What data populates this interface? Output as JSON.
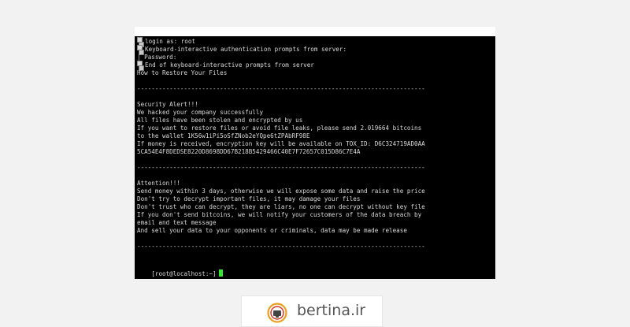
{
  "terminal": {
    "lines": [
      {
        "text": "login as: root",
        "indent": true
      },
      {
        "text": "Keyboard-interactive authentication prompts from server:",
        "indent": true
      },
      {
        "text": "| Password:",
        "indent": false
      },
      {
        "text": "End of keyboard-interactive prompts from server",
        "indent": true
      },
      {
        "text": "How to Restore Your Files",
        "indent": false
      },
      {
        "text": "",
        "indent": false
      },
      {
        "text": "--------------------------------------------------------------------------------",
        "indent": false
      },
      {
        "text": "",
        "indent": false
      },
      {
        "text": "Security Alert!!!",
        "indent": false
      },
      {
        "text": "We hacked your company successfully",
        "indent": false
      },
      {
        "text": "All files have been stolen and encrypted by us",
        "indent": false
      },
      {
        "text": "If you want to restore files or avoid file leaks, please send 2.019664 bitcoins",
        "indent": false
      },
      {
        "text": "to the wallet 1K56w1iPi5oSfZNob2eYQpe6tZPAbRF98E",
        "indent": false
      },
      {
        "text": "If money is received, encryption key will be available on TOX_ID: D6C324719AD0AA",
        "indent": false
      },
      {
        "text": "5CA54E4F8DEDSE8220D8698DD67B218B5429466C40E7F72657C015D86C7E4A",
        "indent": false
      },
      {
        "text": "",
        "indent": false
      },
      {
        "text": "--------------------------------------------------------------------------------",
        "indent": false
      },
      {
        "text": "",
        "indent": false
      },
      {
        "text": "Attention!!!",
        "indent": false
      },
      {
        "text": "Send money within 3 days, otherwise we will expose some data and raise the price",
        "indent": false
      },
      {
        "text": "Don't try to decrypt important files, it may damage your files",
        "indent": false
      },
      {
        "text": "Don't trust who can decrypt, they are liars, no one can decrypt without key file",
        "indent": false
      },
      {
        "text": "If you don't send bitcoins, we will notify your customers of the data breach by",
        "indent": false
      },
      {
        "text": "email and text message",
        "indent": false
      },
      {
        "text": "And sell your data to your opponents or criminals, data may be made release",
        "indent": false
      },
      {
        "text": "",
        "indent": false
      },
      {
        "text": "--------------------------------------------------------------------------------",
        "indent": false
      }
    ],
    "prompt": "[root@localhost:~]",
    "cursor_color": "#35e635"
  },
  "brand": {
    "name": "bertina.ir",
    "logo_icon": "bertina-logo-icon"
  }
}
